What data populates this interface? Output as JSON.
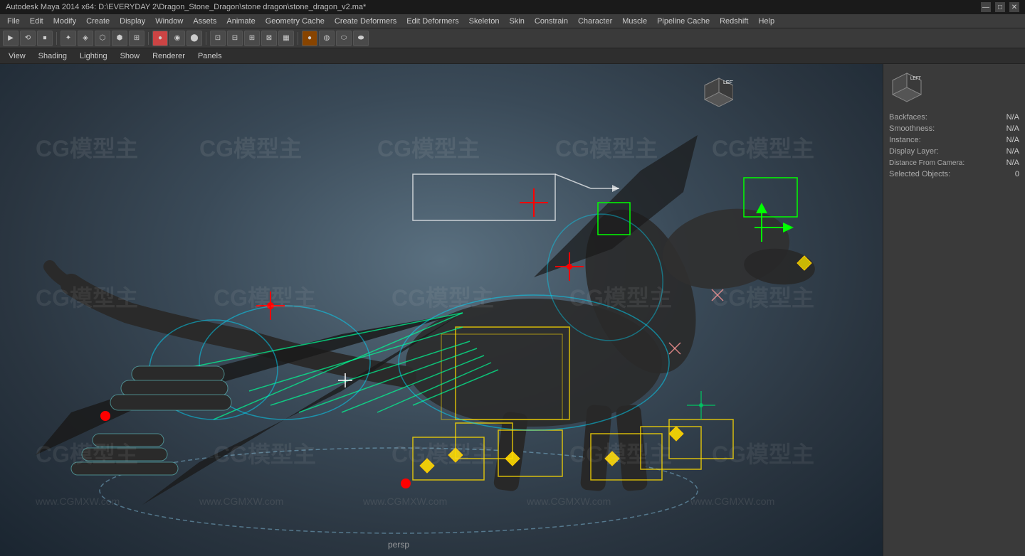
{
  "titlebar": {
    "title": "Autodesk Maya 2014 x64: D:\\EVERYDAY 2\\Dragon_Stone_Dragon\\stone dragon\\stone_dragon_v2.ma*",
    "minimize": "—",
    "maximize": "□",
    "close": "✕"
  },
  "menubar": {
    "items": [
      "File",
      "Edit",
      "Modify",
      "Create",
      "Display",
      "Window",
      "Assets",
      "Animate",
      "Geometry Cache",
      "Create Deformers",
      "Edit Deformers",
      "Skeleton",
      "Skin",
      "Constrain",
      "Character",
      "Muscle",
      "Pipeline Cache",
      "Redshift",
      "Help"
    ]
  },
  "panel_menu": {
    "items": [
      "View",
      "Shading",
      "Lighting",
      "Show",
      "Renderer",
      "Panels"
    ]
  },
  "right_panel": {
    "title": "",
    "rows": [
      {
        "label": "Backfaces:",
        "value": "N/A"
      },
      {
        "label": "Smoothness:",
        "value": "N/A"
      },
      {
        "label": "Instance:",
        "value": "N/A"
      },
      {
        "label": "Display Layer:",
        "value": "N/A"
      },
      {
        "label": "Distance From Camera:",
        "value": "N/A"
      },
      {
        "label": "Selected Objects:",
        "value": "0"
      }
    ]
  },
  "viewport": {
    "label": "persp",
    "left_label": "LEFT"
  },
  "watermarks": [
    "CG模型主",
    "CG模型主",
    "CG模型主",
    "CG模型主",
    "CG模型主",
    "CG模型主"
  ]
}
